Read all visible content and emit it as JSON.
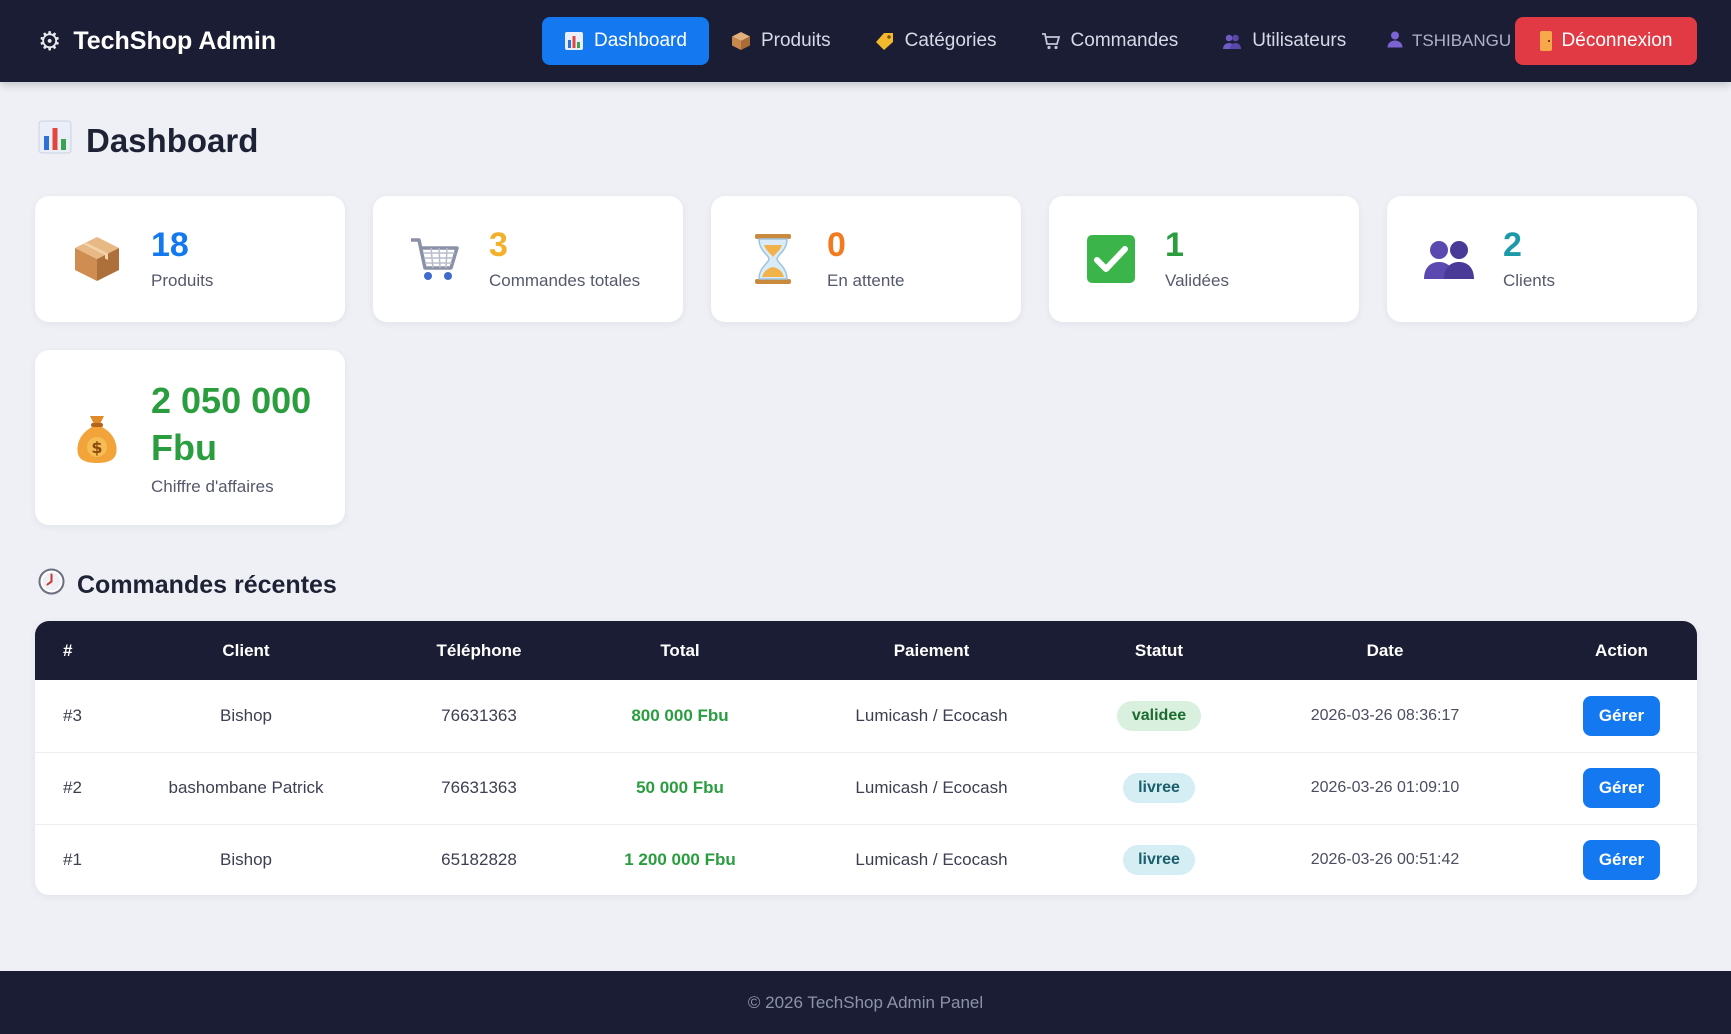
{
  "brand": {
    "title": "TechShop Admin",
    "icon": "gear-icon"
  },
  "nav": {
    "items": [
      {
        "label": "Dashboard",
        "icon": "bar-chart-icon",
        "active": true
      },
      {
        "label": "Produits",
        "icon": "package-icon",
        "active": false
      },
      {
        "label": "Catégories",
        "icon": "tag-icon",
        "active": false
      },
      {
        "label": "Commandes",
        "icon": "cart-icon",
        "active": false
      },
      {
        "label": "Utilisateurs",
        "icon": "users-icon",
        "active": false
      }
    ],
    "user": "TSHIBANGU",
    "logout_label": "Déconnexion"
  },
  "page": {
    "title": "Dashboard"
  },
  "stats": [
    {
      "value": "18",
      "label": "Produits",
      "color": "#1479f0",
      "icon": "package-icon"
    },
    {
      "value": "3",
      "label": "Commandes totales",
      "color": "#f3b12a",
      "icon": "cart-icon"
    },
    {
      "value": "0",
      "label": "En attente",
      "color": "#f27a1f",
      "icon": "hourglass-icon"
    },
    {
      "value": "1",
      "label": "Validées",
      "color": "#2a9d3f",
      "icon": "check-icon"
    },
    {
      "value": "2",
      "label": "Clients",
      "color": "#1d9aa8",
      "icon": "users-icon"
    }
  ],
  "revenue": {
    "value_line1": "2 050 000",
    "value_line2": "Fbu",
    "label": "Chiffre d'affaires",
    "color": "#2a9d3f",
    "icon": "money-bag-icon"
  },
  "recent": {
    "title": "Commandes récentes",
    "columns": [
      "#",
      "Client",
      "Téléphone",
      "Total",
      "Paiement",
      "Statut",
      "Date",
      "Action"
    ],
    "rows": [
      {
        "id": "#3",
        "client": "Bishop",
        "phone": "76631363",
        "total": "800 000 Fbu",
        "payment": "Lumicash / Ecocash",
        "status": "validee",
        "date": "2026-03-26 08:36:17",
        "action": "Gérer"
      },
      {
        "id": "#2",
        "client": "bashombane Patrick",
        "phone": "76631363",
        "total": "50 000 Fbu",
        "payment": "Lumicash / Ecocash",
        "status": "livree",
        "date": "2026-03-26 01:09:10",
        "action": "Gérer"
      },
      {
        "id": "#1",
        "client": "Bishop",
        "phone": "65182828",
        "total": "1 200 000 Fbu",
        "payment": "Lumicash / Ecocash",
        "status": "livree",
        "date": "2026-03-26 00:51:42",
        "action": "Gérer"
      }
    ]
  },
  "footer": {
    "text": "© 2026 TechShop Admin Panel"
  },
  "colors": {
    "navbar": "#1a1d33",
    "accent": "#1479f0",
    "danger": "#e23a44",
    "background": "#eef0f5"
  }
}
